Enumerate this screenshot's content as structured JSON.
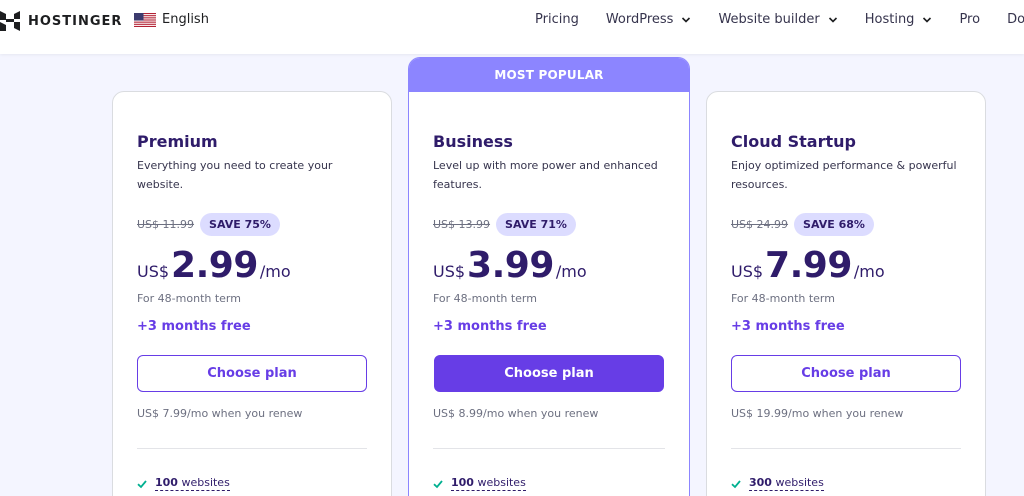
{
  "header": {
    "brand": "HOSTINGER",
    "language": "English",
    "nav": [
      {
        "label": "Pricing",
        "dropdown": false
      },
      {
        "label": "WordPress",
        "dropdown": true
      },
      {
        "label": "Website builder",
        "dropdown": true
      },
      {
        "label": "Hosting",
        "dropdown": true
      },
      {
        "label": "Pro",
        "dropdown": false
      },
      {
        "label": "Domair",
        "dropdown": false
      }
    ]
  },
  "colors": {
    "accent": "#673de6",
    "popular_band": "#8c85ff",
    "heading": "#2f1c6a",
    "badge_bg": "#dcdcff",
    "check": "#00b090"
  },
  "plans": [
    {
      "name": "Premium",
      "description": "Everything you need to create your website.",
      "old_price": "US$ 11.99",
      "save": "SAVE 75%",
      "currency": "US$",
      "price": "2.99",
      "per": "/mo",
      "term": "For 48-month term",
      "bonus": "+3 months free",
      "button": "Choose plan",
      "renew": "US$ 7.99/mo when you renew",
      "feature_bold": "100",
      "feature_rest": " websites"
    },
    {
      "badge": "MOST POPULAR",
      "name": "Business",
      "description": "Level up with more power and enhanced features.",
      "old_price": "US$ 13.99",
      "save": "SAVE 71%",
      "currency": "US$",
      "price": "3.99",
      "per": "/mo",
      "term": "For 48-month term",
      "bonus": "+3 months free",
      "button": "Choose plan",
      "renew": "US$ 8.99/mo when you renew",
      "feature_bold": "100",
      "feature_rest": " websites"
    },
    {
      "name": "Cloud Startup",
      "description": "Enjoy optimized performance & powerful resources.",
      "old_price": "US$ 24.99",
      "save": "SAVE 68%",
      "currency": "US$",
      "price": "7.99",
      "per": "/mo",
      "term": "For 48-month term",
      "bonus": "+3 months free",
      "button": "Choose plan",
      "renew": "US$ 19.99/mo when you renew",
      "feature_bold": "300",
      "feature_rest": " websites"
    }
  ]
}
